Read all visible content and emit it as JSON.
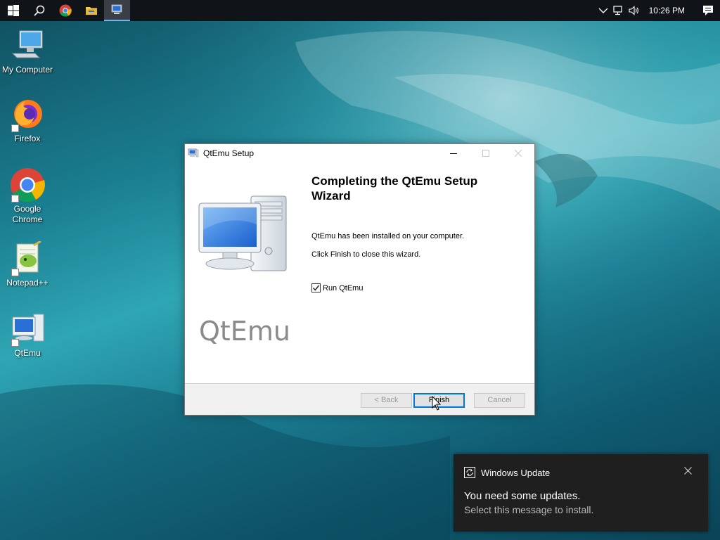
{
  "taskbar": {
    "icons": [
      "windows-start-icon",
      "search-icon",
      "chrome-icon",
      "file-explorer-icon",
      "qtemu-taskbar-icon"
    ],
    "tray_icons": [
      "chevron-up-icon",
      "network-icon",
      "volume-icon"
    ],
    "clock": "10:26 PM"
  },
  "desktop": {
    "icons": [
      {
        "label": "My Computer"
      },
      {
        "label": "Firefox"
      },
      {
        "label": "Google Chrome"
      },
      {
        "label": "Notepad++"
      },
      {
        "label": "QtEmu"
      }
    ]
  },
  "dialog": {
    "title": "QtEmu Setup",
    "brand": "QtEmu",
    "heading": "Completing the QtEmu Setup Wizard",
    "message1": "QtEmu has been installed on your computer.",
    "message2": "Click Finish to close this wizard.",
    "checkbox_label": "Run QtEmu",
    "checkbox_checked": true,
    "buttons": {
      "back": "< Back",
      "finish": "Finish",
      "cancel": "Cancel"
    }
  },
  "toast": {
    "app": "Windows Update",
    "title": "You need some updates.",
    "subtitle": "Select this message to install."
  },
  "colors": {
    "accent": "#0078d7",
    "taskbar": "#101418",
    "toast_bg": "#1f1f1f"
  }
}
